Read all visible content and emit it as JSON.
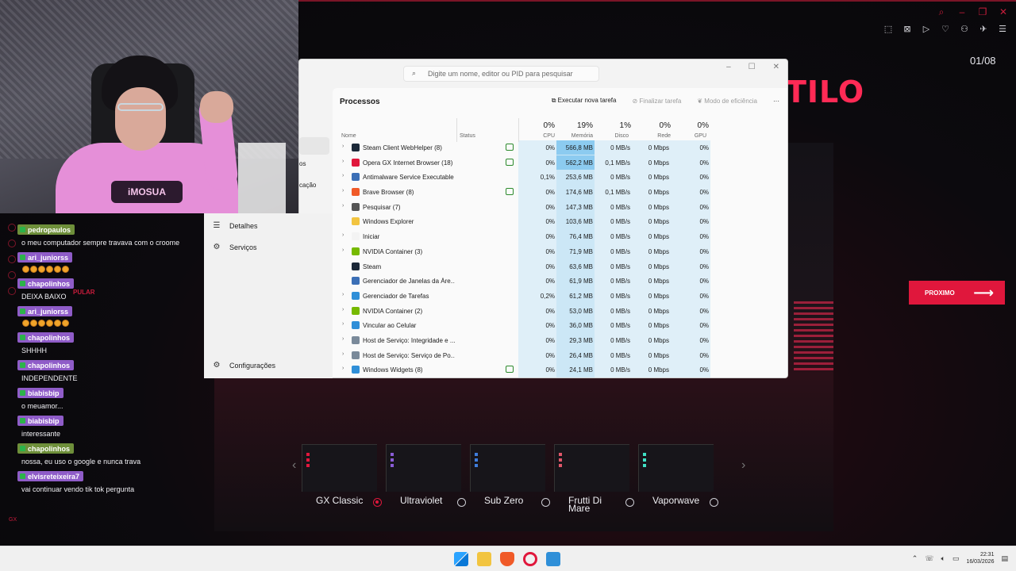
{
  "page": {
    "counter": "01/08",
    "headline_fragment": "TILO",
    "next_label": "PROXIMO",
    "skip_label": "PULAR"
  },
  "themes": [
    {
      "name": "GX Classic",
      "accent": "#e0173c",
      "selected": true
    },
    {
      "name": "Ultraviolet",
      "accent": "#8a5cd6",
      "selected": false
    },
    {
      "name": "Sub Zero",
      "accent": "#3f7ddb",
      "selected": false
    },
    {
      "name": "Frutti Di Mare",
      "accent": "#e0576a",
      "selected": false
    },
    {
      "name": "Vaporwave",
      "accent": "#3fe0c4",
      "selected": false
    }
  ],
  "webcam": {
    "shirt_text": "iMOSUA"
  },
  "chat": [
    {
      "user": "pedropaulos",
      "text": "o meu computador sempre travava com o croome",
      "emotes": 0
    },
    {
      "user": "ari_juniorss",
      "text": "",
      "emotes": 6
    },
    {
      "user": "chapolinhos",
      "text": "DEIXA BAIXO",
      "emotes": 0
    },
    {
      "user": "ari_juniorss",
      "text": "",
      "emotes": 6
    },
    {
      "user": "chapolinhos",
      "text": "SHHHH",
      "emotes": 0
    },
    {
      "user": "chapolinhos",
      "text": "INDEPENDENTE",
      "emotes": 0
    },
    {
      "user": "biabisbip",
      "text": "o meuamor...",
      "emotes": 0
    },
    {
      "user": "biabisbip",
      "text": "interessante",
      "emotes": 0
    },
    {
      "user": "chapolinhos",
      "text": "nossa, eu uso o google e nunca trava",
      "emotes": 0
    },
    {
      "user": "elvisreteixeira7",
      "text": "vai continuar vendo tik tok pergunta",
      "emotes": 0
    }
  ],
  "task_manager": {
    "search_placeholder": "Digite um nome, editor ou PID para pesquisar",
    "heading": "Processos",
    "run_task": "Executar nova tarefa",
    "end_task": "Finalizar tarefa",
    "efficiency": "Modo de eficiência",
    "more": "···",
    "nav_fragments": [
      "os",
      "cação"
    ],
    "details": "Detalhes",
    "services": "Serviços",
    "settings": "Configurações",
    "columns": {
      "name": "Nome",
      "status": "Status",
      "cpu_pct": "0%",
      "cpu": "CPU",
      "mem_pct": "19%",
      "mem": "Memória",
      "disk_pct": "1%",
      "disk": "Disco",
      "net_pct": "0%",
      "net": "Rede",
      "gpu_pct": "0%",
      "gpu": "GPU"
    },
    "rows": [
      {
        "name": "Steam Client WebHelper (8)",
        "expand": true,
        "leaf": true,
        "icon": "#1b2838",
        "cpu": "0%",
        "mem": "566,8 MB",
        "disk": "0 MB/s",
        "net": "0 Mbps",
        "gpu": "0%",
        "mem_hi": true
      },
      {
        "name": "Opera GX Internet Browser (18)",
        "expand": true,
        "leaf": true,
        "icon": "#e0173c",
        "cpu": "0%",
        "mem": "562,2 MB",
        "disk": "0,1 MB/s",
        "net": "0 Mbps",
        "gpu": "0%",
        "mem_hi": true
      },
      {
        "name": "Antimalware Service Executable",
        "expand": true,
        "leaf": false,
        "icon": "#3b6fb6",
        "cpu": "0,1%",
        "mem": "253,6 MB",
        "disk": "0 MB/s",
        "net": "0 Mbps",
        "gpu": "0%",
        "mem_hi": false
      },
      {
        "name": "Brave Browser (8)",
        "expand": true,
        "leaf": true,
        "icon": "#f05a28",
        "cpu": "0%",
        "mem": "174,6 MB",
        "disk": "0,1 MB/s",
        "net": "0 Mbps",
        "gpu": "0%",
        "mem_hi": false
      },
      {
        "name": "Pesquisar (7)",
        "expand": true,
        "leaf": false,
        "icon": "#555555",
        "cpu": "0%",
        "mem": "147,3 MB",
        "disk": "0 MB/s",
        "net": "0 Mbps",
        "gpu": "0%",
        "mem_hi": false
      },
      {
        "name": "Windows Explorer",
        "expand": false,
        "leaf": false,
        "icon": "#f2c440",
        "cpu": "0%",
        "mem": "103,6 MB",
        "disk": "0 MB/s",
        "net": "0 Mbps",
        "gpu": "0%",
        "mem_hi": false
      },
      {
        "name": "Iniciar",
        "expand": true,
        "leaf": false,
        "icon": "#f3f3f3",
        "cpu": "0%",
        "mem": "76,4 MB",
        "disk": "0 MB/s",
        "net": "0 Mbps",
        "gpu": "0%",
        "mem_hi": false
      },
      {
        "name": "NVIDIA Container (3)",
        "expand": true,
        "leaf": false,
        "icon": "#76b900",
        "cpu": "0%",
        "mem": "71,9 MB",
        "disk": "0 MB/s",
        "net": "0 Mbps",
        "gpu": "0%",
        "mem_hi": false
      },
      {
        "name": "Steam",
        "expand": false,
        "leaf": false,
        "icon": "#1b2838",
        "cpu": "0%",
        "mem": "63,6 MB",
        "disk": "0 MB/s",
        "net": "0 Mbps",
        "gpu": "0%",
        "mem_hi": false
      },
      {
        "name": "Gerenciador de Janelas da Áre...",
        "expand": false,
        "leaf": false,
        "icon": "#3b6fb6",
        "cpu": "0%",
        "mem": "61,9 MB",
        "disk": "0 MB/s",
        "net": "0 Mbps",
        "gpu": "0%",
        "mem_hi": false
      },
      {
        "name": "Gerenciador de Tarefas",
        "expand": true,
        "leaf": false,
        "icon": "#2f8fd8",
        "cpu": "0,2%",
        "mem": "61,2 MB",
        "disk": "0 MB/s",
        "net": "0 Mbps",
        "gpu": "0%",
        "mem_hi": false
      },
      {
        "name": "NVIDIA Container (2)",
        "expand": true,
        "leaf": false,
        "icon": "#76b900",
        "cpu": "0%",
        "mem": "53,0 MB",
        "disk": "0 MB/s",
        "net": "0 Mbps",
        "gpu": "0%",
        "mem_hi": false
      },
      {
        "name": "Vincular ao Celular",
        "expand": true,
        "leaf": false,
        "icon": "#2f8fd8",
        "cpu": "0%",
        "mem": "36,0 MB",
        "disk": "0 MB/s",
        "net": "0 Mbps",
        "gpu": "0%",
        "mem_hi": false
      },
      {
        "name": "Host de Serviço: Integridade e ...",
        "expand": true,
        "leaf": false,
        "icon": "#7a8a9a",
        "cpu": "0%",
        "mem": "29,3 MB",
        "disk": "0 MB/s",
        "net": "0 Mbps",
        "gpu": "0%",
        "mem_hi": false
      },
      {
        "name": "Host de Serviço: Serviço de Po...",
        "expand": true,
        "leaf": false,
        "icon": "#7a8a9a",
        "cpu": "0%",
        "mem": "26,4 MB",
        "disk": "0 MB/s",
        "net": "0 Mbps",
        "gpu": "0%",
        "mem_hi": false
      },
      {
        "name": "Windows Widgets (8)",
        "expand": true,
        "leaf": true,
        "icon": "#2f8fd8",
        "cpu": "0%",
        "mem": "24,1 MB",
        "disk": "0 MB/s",
        "net": "0 Mbps",
        "gpu": "0%",
        "mem_hi": false
      }
    ]
  },
  "taskbar": {
    "time": "22:31",
    "date": "16/03/2026",
    "apps": [
      "windows-start-icon",
      "file-explorer-icon",
      "brave-icon",
      "opera-icon",
      "task-manager-icon"
    ]
  }
}
